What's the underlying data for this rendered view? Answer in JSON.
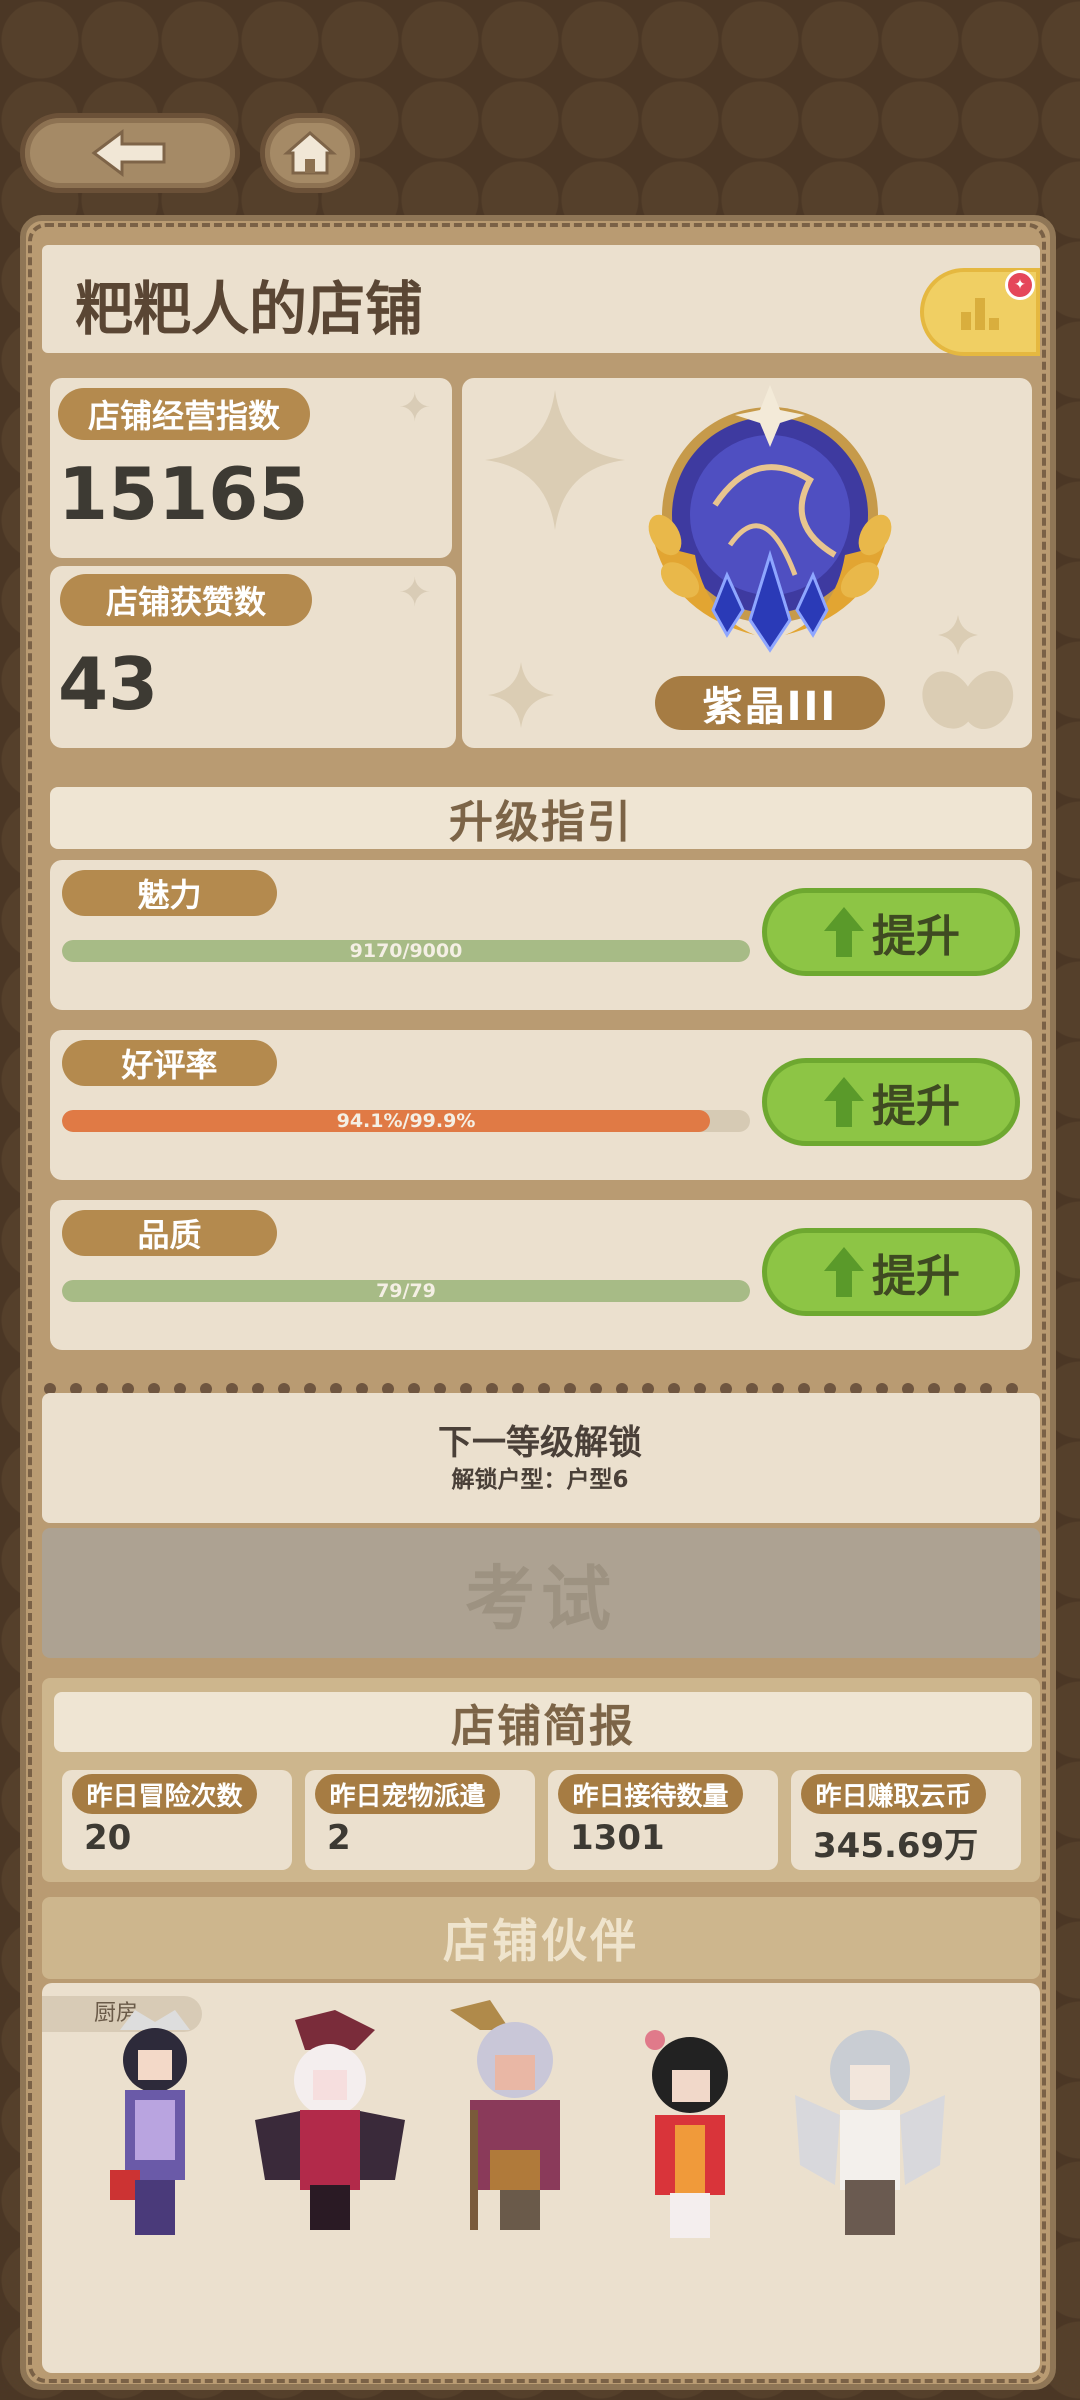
{
  "colors": {
    "accent_label": "#b48a4e",
    "progress_green": "#a7bb86",
    "progress_orange": "#e07a45",
    "upgrade_green": "#8dc545",
    "rank_button": "#f0cf63"
  },
  "nav": {
    "back_icon": "arrow-left-icon",
    "home_icon": "home-icon"
  },
  "header": {
    "title": "粑粑人的店铺",
    "rank_icon": "bar-chart-icon"
  },
  "stats": {
    "operation_index": {
      "label": "店铺经营指数",
      "value": "15165"
    },
    "likes": {
      "label": "店铺获赞数",
      "value": "43"
    }
  },
  "badge": {
    "name": "紫晶III"
  },
  "guide": {
    "title": "升级指引",
    "rows": [
      {
        "label": "魅力",
        "progress_text": "9170/9000",
        "progress": 1.0,
        "button": "提升"
      },
      {
        "label": "好评率",
        "progress_text": "94.1%/99.9%",
        "progress": 0.942,
        "button": "提升"
      },
      {
        "label": "品质",
        "progress_text": "79/79",
        "progress": 1.0,
        "button": "提升"
      }
    ]
  },
  "unlock": {
    "title": "下一等级解锁",
    "subtitle": "解锁户型：户型6"
  },
  "exam": {
    "label": "考试"
  },
  "brief": {
    "title": "店铺简报",
    "items": [
      {
        "label": "昨日冒险次数",
        "value": "20"
      },
      {
        "label": "昨日宠物派遣",
        "value": "2"
      },
      {
        "label": "昨日接待数量",
        "value": "1301"
      },
      {
        "label": "昨日赚取云币",
        "value": "345.69万"
      }
    ]
  },
  "partners": {
    "title": "店铺伙伴",
    "tag": "厨房"
  }
}
